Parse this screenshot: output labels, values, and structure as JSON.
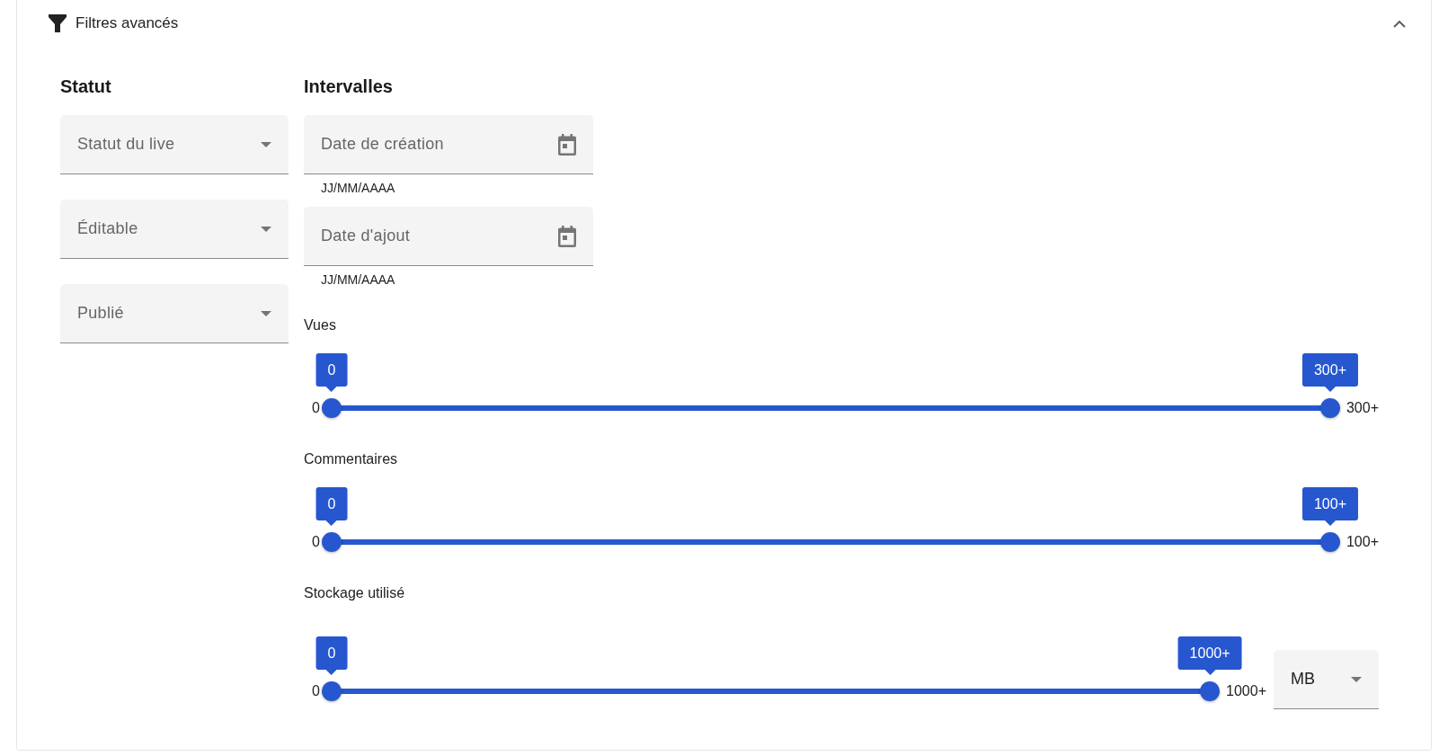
{
  "panel": {
    "title": "Filtres avancés",
    "expanded": true
  },
  "status": {
    "heading": "Statut",
    "selects": [
      {
        "label": "Statut du live"
      },
      {
        "label": "Éditable"
      },
      {
        "label": "Publié"
      }
    ]
  },
  "ranges": {
    "heading": "Intervalles",
    "dates": [
      {
        "placeholder": "Date de création",
        "helper": "JJ/MM/AAAA"
      },
      {
        "placeholder": "Date d'ajout",
        "helper": "JJ/MM/AAAA"
      }
    ],
    "sliders": [
      {
        "label": "Vues",
        "min_label": "0",
        "max_label": "300+",
        "thumbs": [
          {
            "tooltip": "0",
            "level": 0
          },
          {
            "tooltip": "300+",
            "level": 1
          }
        ]
      },
      {
        "label": "Commentaires",
        "min_label": "0",
        "max_label": "100+",
        "thumbs": [
          {
            "tooltip": "0",
            "level": 0
          },
          {
            "tooltip": "100+",
            "level": 1
          }
        ]
      },
      {
        "label": "Stockage utilisé",
        "min_label": "0",
        "max_label": "1000+",
        "thumbs": [
          {
            "tooltip": "0",
            "level": 0
          },
          {
            "tooltip": "1000+",
            "level": 1
          }
        ],
        "unit": {
          "value": "MB"
        }
      }
    ]
  }
}
